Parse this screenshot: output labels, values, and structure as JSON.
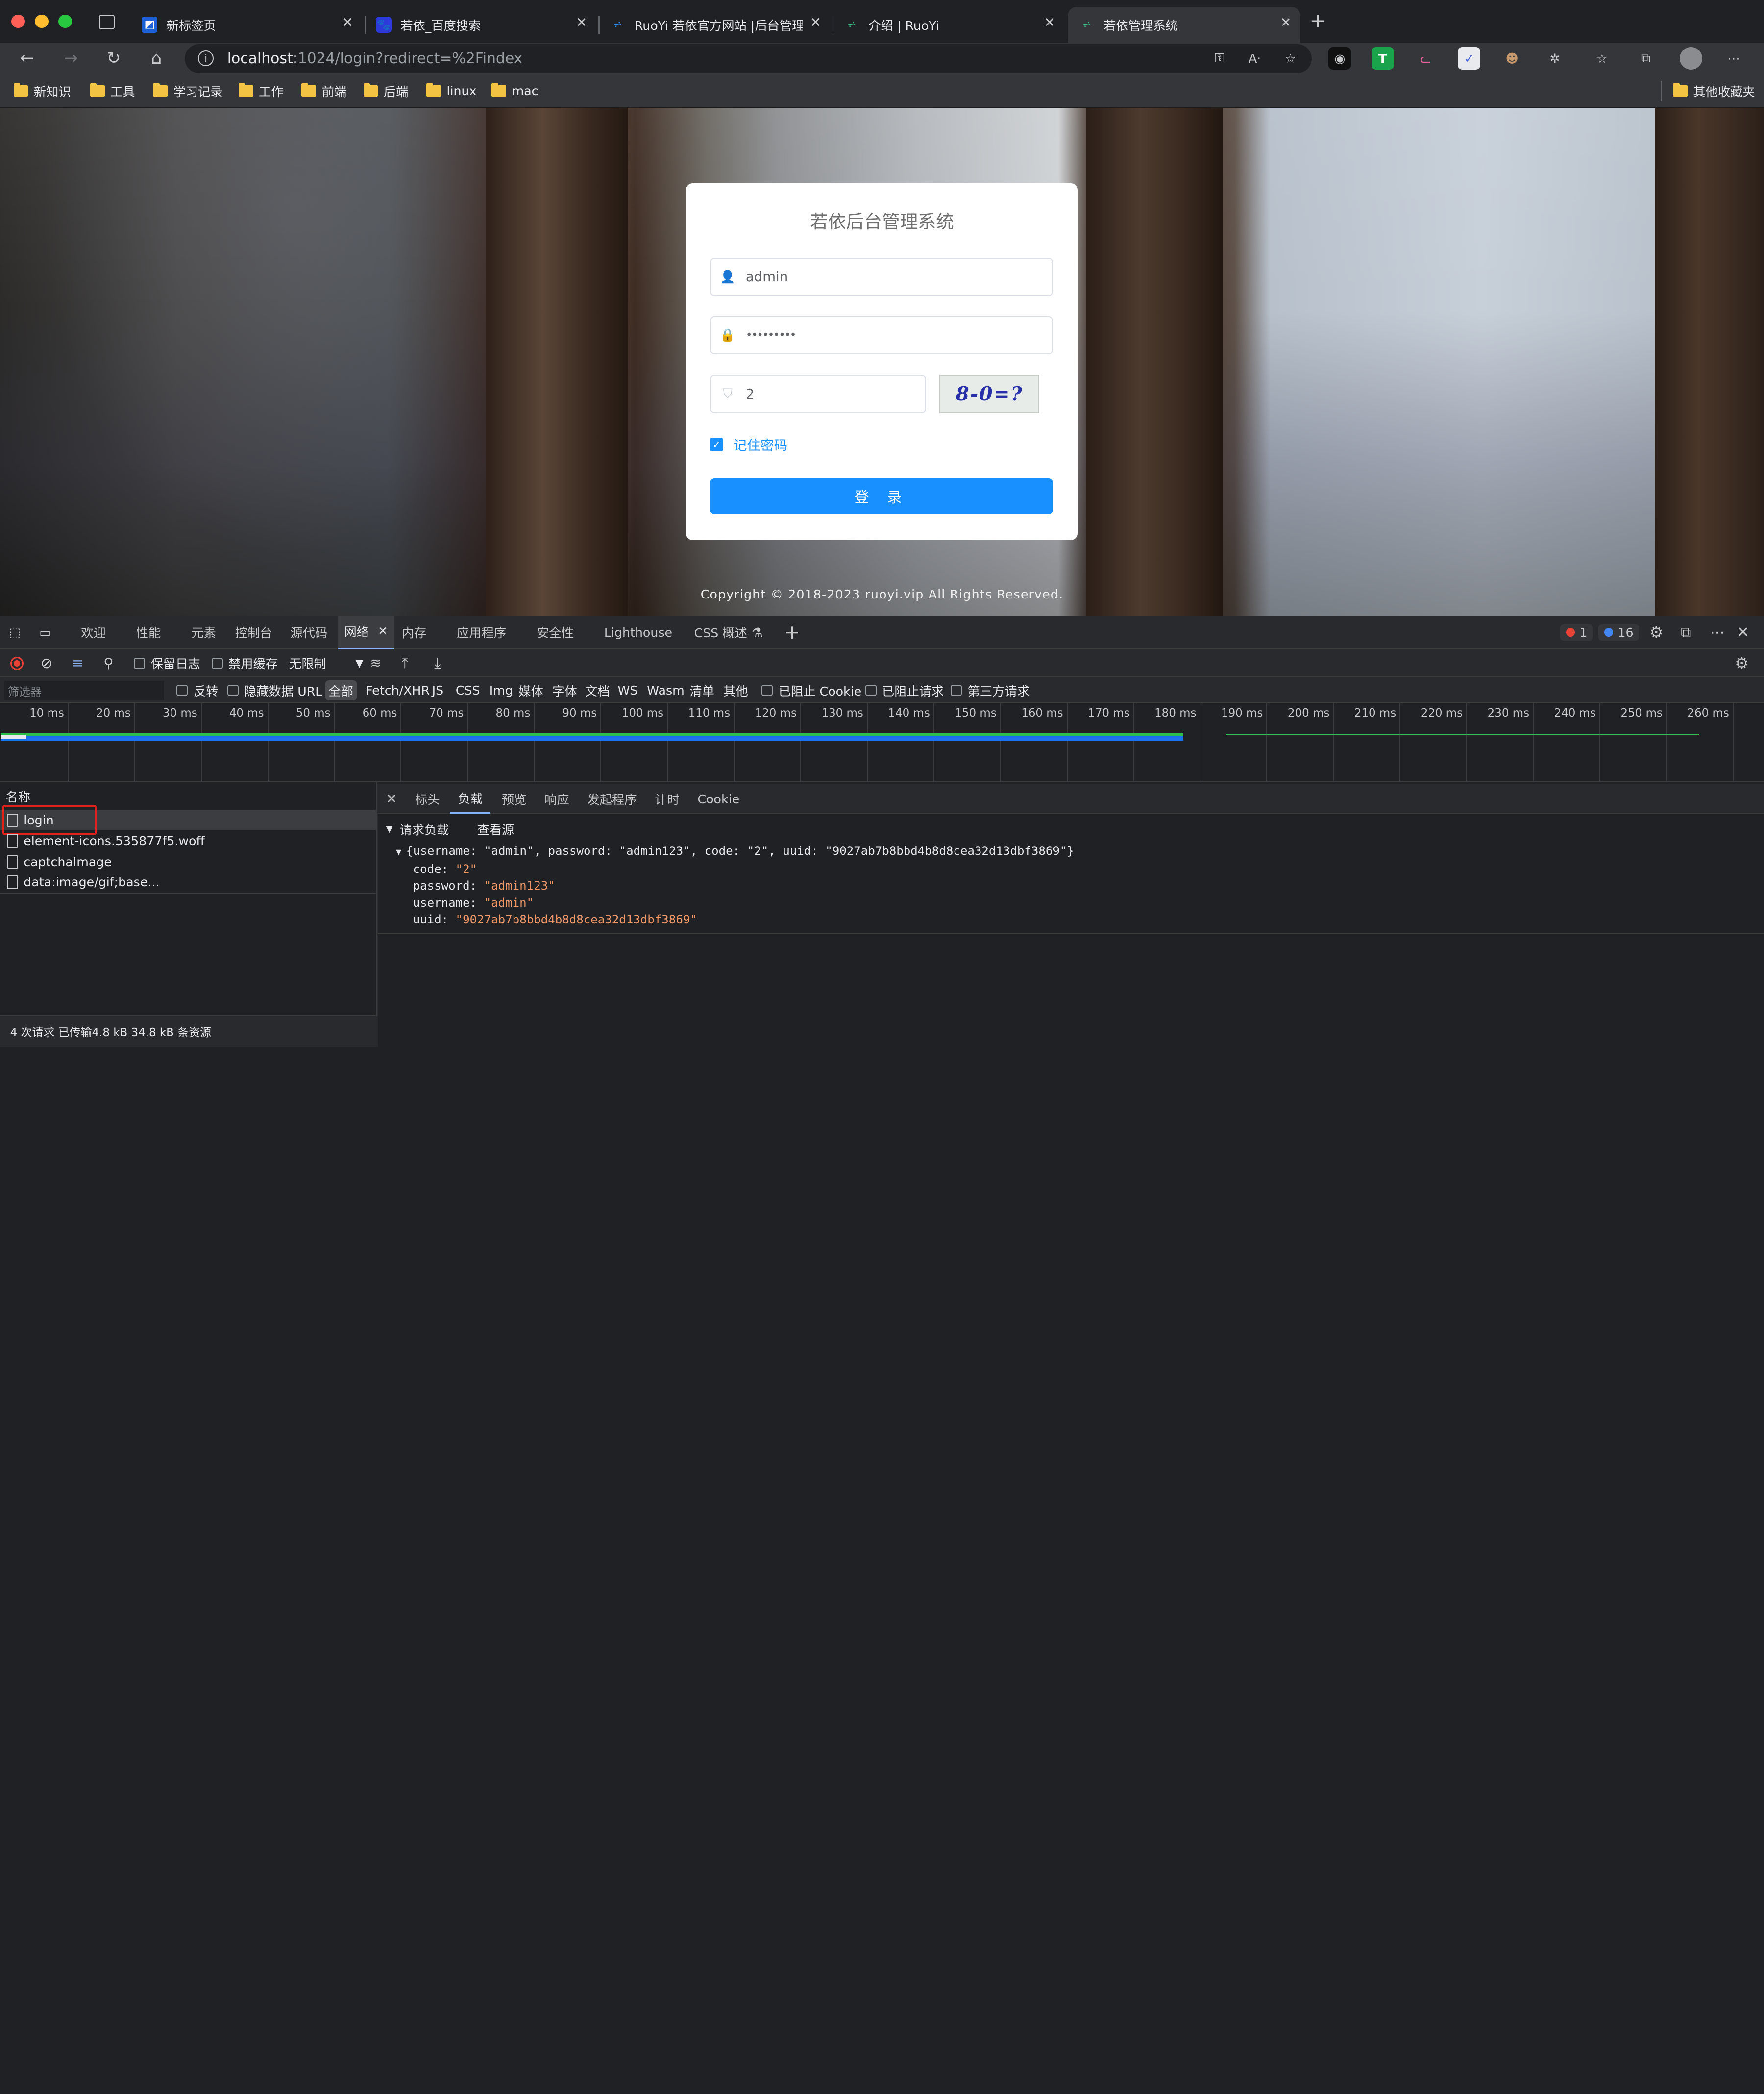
{
  "browser": {
    "tabs": [
      {
        "title": "新标签页"
      },
      {
        "title": "若依_百度搜索"
      },
      {
        "title": "RuoYi 若依官方网站 |后台管理系"
      },
      {
        "title": "介绍 | RuoYi"
      },
      {
        "title": "若依管理系统",
        "active": true
      }
    ],
    "new_tab_symbol": "+",
    "address": {
      "host": "localhost",
      "path": ":1024/login?redirect=%2Findex"
    },
    "bookmarks": [
      "新知识",
      "工具",
      "学习记录",
      "工作",
      "前端",
      "后端",
      "linux",
      "mac"
    ],
    "other_bookmarks": "其他收藏夹"
  },
  "login": {
    "title": "若依后台管理系统",
    "username": "admin",
    "password_mask": "•••••••••",
    "code": "2",
    "captcha_text": "8-0=?",
    "remember_label": "记住密码",
    "login_button": "登 录",
    "copyright": "Copyright © 2018-2023 ruoyi.vip All Rights Reserved."
  },
  "devtools": {
    "tabs": [
      "欢迎",
      "性能",
      "元素",
      "控制台",
      "源代码",
      "网络",
      "内存",
      "应用程序",
      "安全性",
      "Lighthouse",
      "CSS 概述"
    ],
    "active_tab": "网络",
    "error_count": "1",
    "info_count": "16",
    "toolbar": {
      "preserve_log": "保留日志",
      "disable_cache": "禁用缓存",
      "throttle": "无限制"
    },
    "filter": {
      "placeholder": "筛选器",
      "invert": "反转",
      "hide_data_urls": "隐藏数据 URL",
      "types": [
        "全部",
        "Fetch/XHR",
        "JS",
        "CSS",
        "Img",
        "媒体",
        "字体",
        "文档",
        "WS",
        "Wasm",
        "清单",
        "其他"
      ],
      "blocked_cookies": "已阻止 Cookie",
      "blocked_requests": "已阻止请求",
      "third_party": "第三方请求"
    },
    "timeline_ticks": [
      "10 ms",
      "20 ms",
      "30 ms",
      "40 ms",
      "50 ms",
      "60 ms",
      "70 ms",
      "80 ms",
      "90 ms",
      "100 ms",
      "110 ms",
      "120 ms",
      "130 ms",
      "140 ms",
      "150 ms",
      "160 ms",
      "170 ms",
      "180 ms",
      "190 ms",
      "200 ms",
      "210 ms",
      "220 ms",
      "230 ms",
      "240 ms",
      "250 ms",
      "260 ms"
    ],
    "requests": {
      "header": "名称",
      "items": [
        "login",
        "element-icons.535877f5.woff",
        "captchaImage",
        "data:image/gif;base..."
      ]
    },
    "status": "4 次请求  已传输4.8 kB  34.8 kB 条资源",
    "detail": {
      "tabs": [
        "标头",
        "负载",
        "预览",
        "响应",
        "发起程序",
        "计时",
        "Cookie"
      ],
      "active_tab": "负载",
      "section_title": "请求负载",
      "view_source": "查看源",
      "payload_summary": "{username: \"admin\", password: \"admin123\", code: \"2\", uuid: \"9027ab7b8bbd4b8d8cea32d13dbf3869\"}",
      "fields": [
        {
          "key": "code",
          "value": "\"2\""
        },
        {
          "key": "password",
          "value": "\"admin123\""
        },
        {
          "key": "username",
          "value": "\"admin\""
        },
        {
          "key": "uuid",
          "value": "\"9027ab7b8bbd4b8d8cea32d13dbf3869\""
        }
      ]
    }
  }
}
